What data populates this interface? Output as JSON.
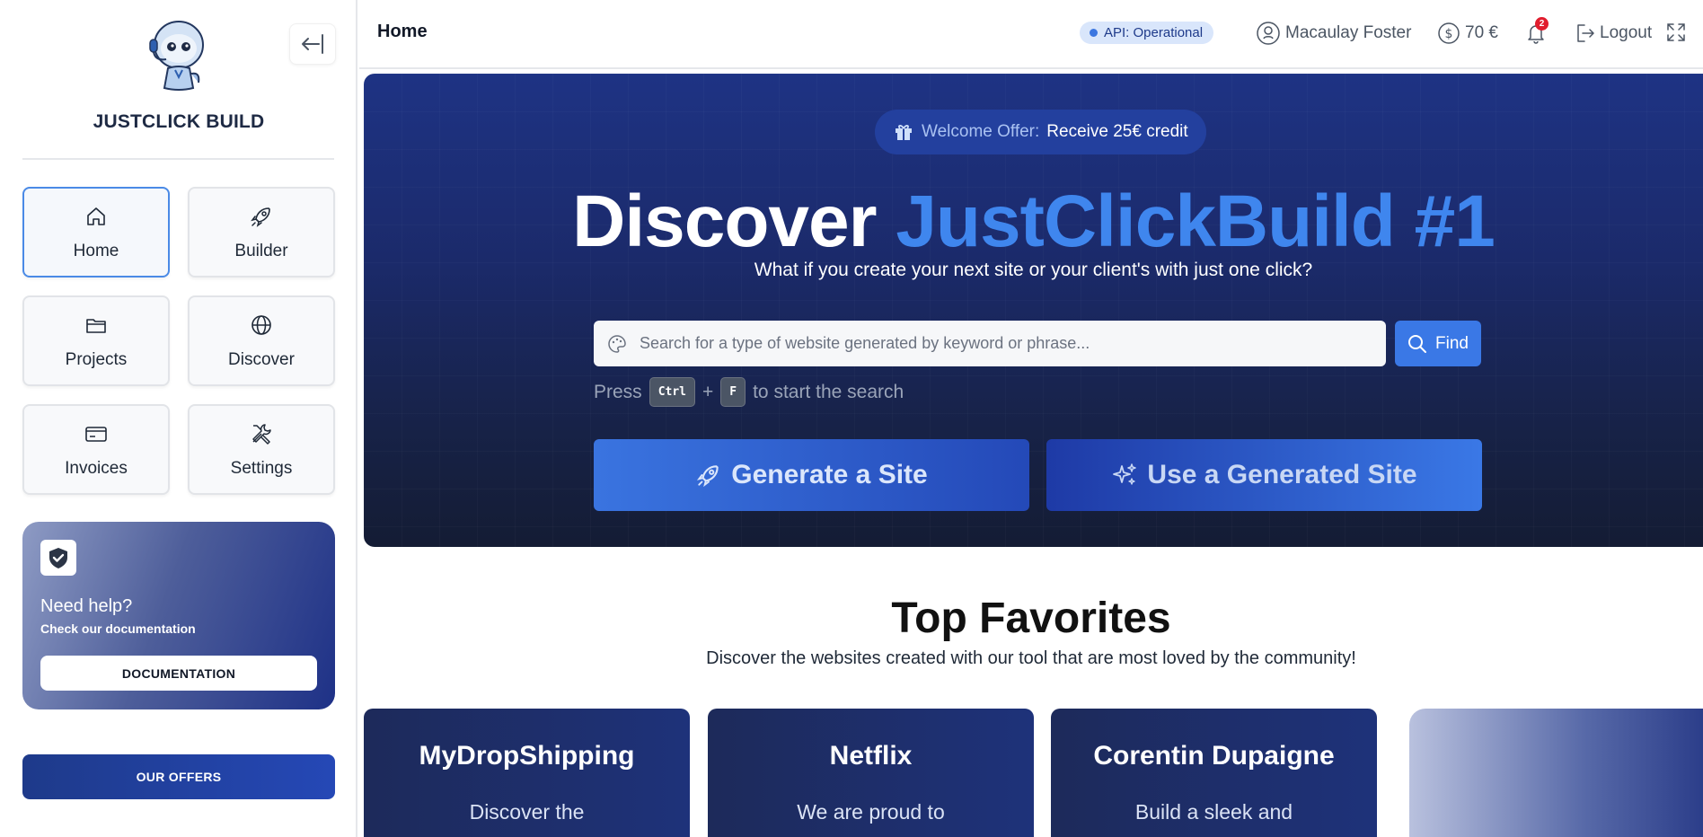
{
  "sidebar": {
    "brand": "JUSTCLICK BUILD",
    "nav": [
      {
        "label": "Home",
        "icon": "home-icon",
        "active": true
      },
      {
        "label": "Builder",
        "icon": "rocket-icon",
        "active": false
      },
      {
        "label": "Projects",
        "icon": "folder-icon",
        "active": false
      },
      {
        "label": "Discover",
        "icon": "globe-icon",
        "active": false
      },
      {
        "label": "Invoices",
        "icon": "card-icon",
        "active": false
      },
      {
        "label": "Settings",
        "icon": "tools-icon",
        "active": false
      }
    ],
    "help": {
      "title": "Need help?",
      "subtitle": "Check our documentation",
      "button": "DOCUMENTATION"
    },
    "offers_button": "OUR OFFERS"
  },
  "topbar": {
    "title": "Home",
    "api_status": "API: Operational",
    "user_name": "Macaulay Foster",
    "balance": "70 €",
    "notifications_count": "2",
    "logout": "Logout"
  },
  "hero": {
    "offer_prefix": "Welcome Offer:",
    "offer_text": "Receive 25€ credit",
    "title_white": "Discover",
    "title_blue": "JustClickBuild #1",
    "subtitle": "What if you create your next site or your client's with just one click?",
    "search_placeholder": "Search for a type of website generated by keyword or phrase...",
    "find_button": "Find",
    "shortcut_press": "Press",
    "shortcut_key1": "Ctrl",
    "shortcut_plus": "+",
    "shortcut_key2": "F",
    "shortcut_suffix": "to start the search",
    "generate_button": "Generate a Site",
    "use_button": "Use a Generated Site"
  },
  "favorites": {
    "title": "Top Favorites",
    "subtitle": "Discover the websites created with our tool that are most loved by the community!",
    "cards": [
      {
        "title": "MyDropShipping",
        "desc": "Discover the"
      },
      {
        "title": "Netflix",
        "desc": "We are proud to"
      },
      {
        "title": "Corentin Dupaigne",
        "desc": "Build a sleek and"
      }
    ]
  },
  "colors": {
    "accent": "#3a78e6",
    "hero_dark": "#172247",
    "brand_blue": "#1e3a8a",
    "notification_red": "#e11d2e"
  }
}
